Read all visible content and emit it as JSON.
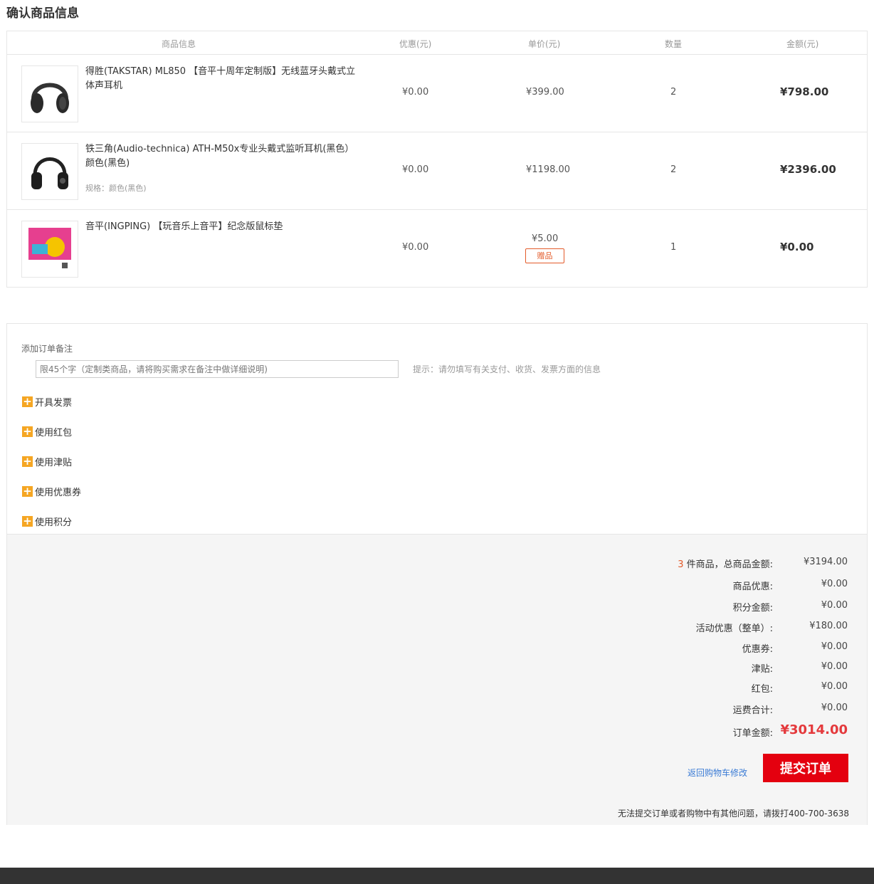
{
  "page": {
    "title": "确认商品信息"
  },
  "table": {
    "headers": {
      "info": "商品信息",
      "discount": "优惠(元)",
      "price": "单价(元)",
      "qty": "数量",
      "amount": "金额(元)"
    },
    "rows": [
      {
        "name": "得胜(TAKSTAR) ML850 【音平十周年定制版】无线蓝牙头戴式立体声耳机",
        "spec": "",
        "discount": "¥0.00",
        "price": "¥399.00",
        "qty": "2",
        "amount": "¥798.00"
      },
      {
        "name": "铁三角(Audio-technica) ATH-M50x专业头戴式监听耳机(黑色）颜色(黑色)",
        "spec": "规格：颜色(黑色)",
        "discount": "¥0.00",
        "price": "¥1198.00",
        "qty": "2",
        "amount": "¥2396.00"
      },
      {
        "name": "音平(INGPING) 【玩音乐上音平】纪念版鼠标垫",
        "spec": "",
        "discount": "¥0.00",
        "price": "¥5.00",
        "gift": "赠品",
        "qty": "1",
        "amount": "¥0.00"
      }
    ]
  },
  "remark": {
    "label": "添加订单备注",
    "placeholder": "限45个字（定制类商品，请将购买需求在备注中做详细说明)",
    "hint": "提示：请勿填写有关支付、收货、发票方面的信息"
  },
  "options": [
    "开具发票",
    "使用红包",
    "使用津贴",
    "使用优惠券",
    "使用积分"
  ],
  "summary": {
    "count": "3",
    "count_suffix": " 件商品，总商品金额:",
    "goods_total": "¥3194.00",
    "rows": [
      {
        "label": "商品优惠:",
        "value": "¥0.00"
      },
      {
        "label": "积分金额:",
        "value": "¥0.00"
      },
      {
        "label": "活动优惠（整单）:",
        "value": "¥180.00"
      },
      {
        "label": "优惠券:",
        "value": "¥0.00"
      },
      {
        "label": "津贴:",
        "value": "¥0.00"
      },
      {
        "label": "红包:",
        "value": "¥0.00"
      },
      {
        "label": "运费合计:",
        "value": "¥0.00"
      }
    ],
    "total_label": "订单金额:",
    "total_value": "¥3014.00",
    "back_link": "返回购物车修改",
    "submit": "提交订单",
    "help": "无法提交订单或者购物中有其他问题，请拨打400-700-3638"
  },
  "colors": {
    "accent": "#e4000f",
    "price_red": "#e4393c",
    "plus_icon": "#f5a623",
    "link": "#3a7bd5"
  }
}
